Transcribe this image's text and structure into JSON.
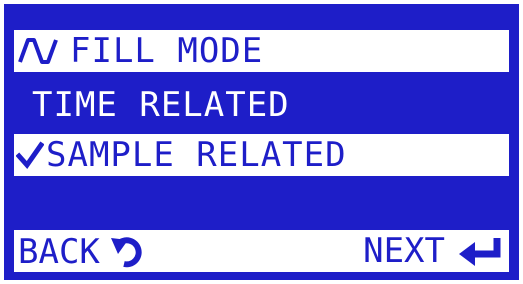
{
  "menu": {
    "title": "FILL MODE",
    "title_icon": "sine-wave-icon",
    "options": [
      {
        "label": "TIME RELATED",
        "selected": false
      },
      {
        "label": "SAMPLE RELATED",
        "selected": true
      }
    ],
    "selected_icon": "checkmark-icon"
  },
  "footer": {
    "back_label": "BACK",
    "back_icon": "rotate-back-icon",
    "next_label": "NEXT",
    "next_icon": "enter-arrow-icon"
  },
  "colors": {
    "background": "#1e1ec8",
    "highlight": "#ffffff"
  }
}
